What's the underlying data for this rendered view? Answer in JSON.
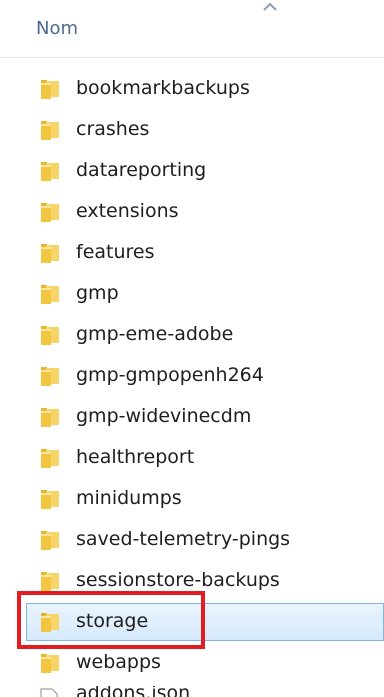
{
  "header": {
    "column_label": "Nom",
    "sort_indicator": "sort-ascending-icon"
  },
  "folders": [
    {
      "name": "bookmarkbackups"
    },
    {
      "name": "crashes"
    },
    {
      "name": "datareporting"
    },
    {
      "name": "extensions"
    },
    {
      "name": "features"
    },
    {
      "name": "gmp"
    },
    {
      "name": "gmp-eme-adobe"
    },
    {
      "name": "gmp-gmpopenh264"
    },
    {
      "name": "gmp-widevinecdm"
    },
    {
      "name": "healthreport"
    },
    {
      "name": "minidumps"
    },
    {
      "name": "saved-telemetry-pings"
    },
    {
      "name": "sessionstore-backups"
    },
    {
      "name": "storage",
      "selected": true,
      "highlighted": true
    },
    {
      "name": "webapps"
    }
  ],
  "partial_file": {
    "name": "addons.json"
  },
  "colors": {
    "highlight_border": "#e11d22",
    "selection_border": "#7fb5e8",
    "header_text": "#4c6a8c",
    "folder_yellow": "#f2c640"
  }
}
